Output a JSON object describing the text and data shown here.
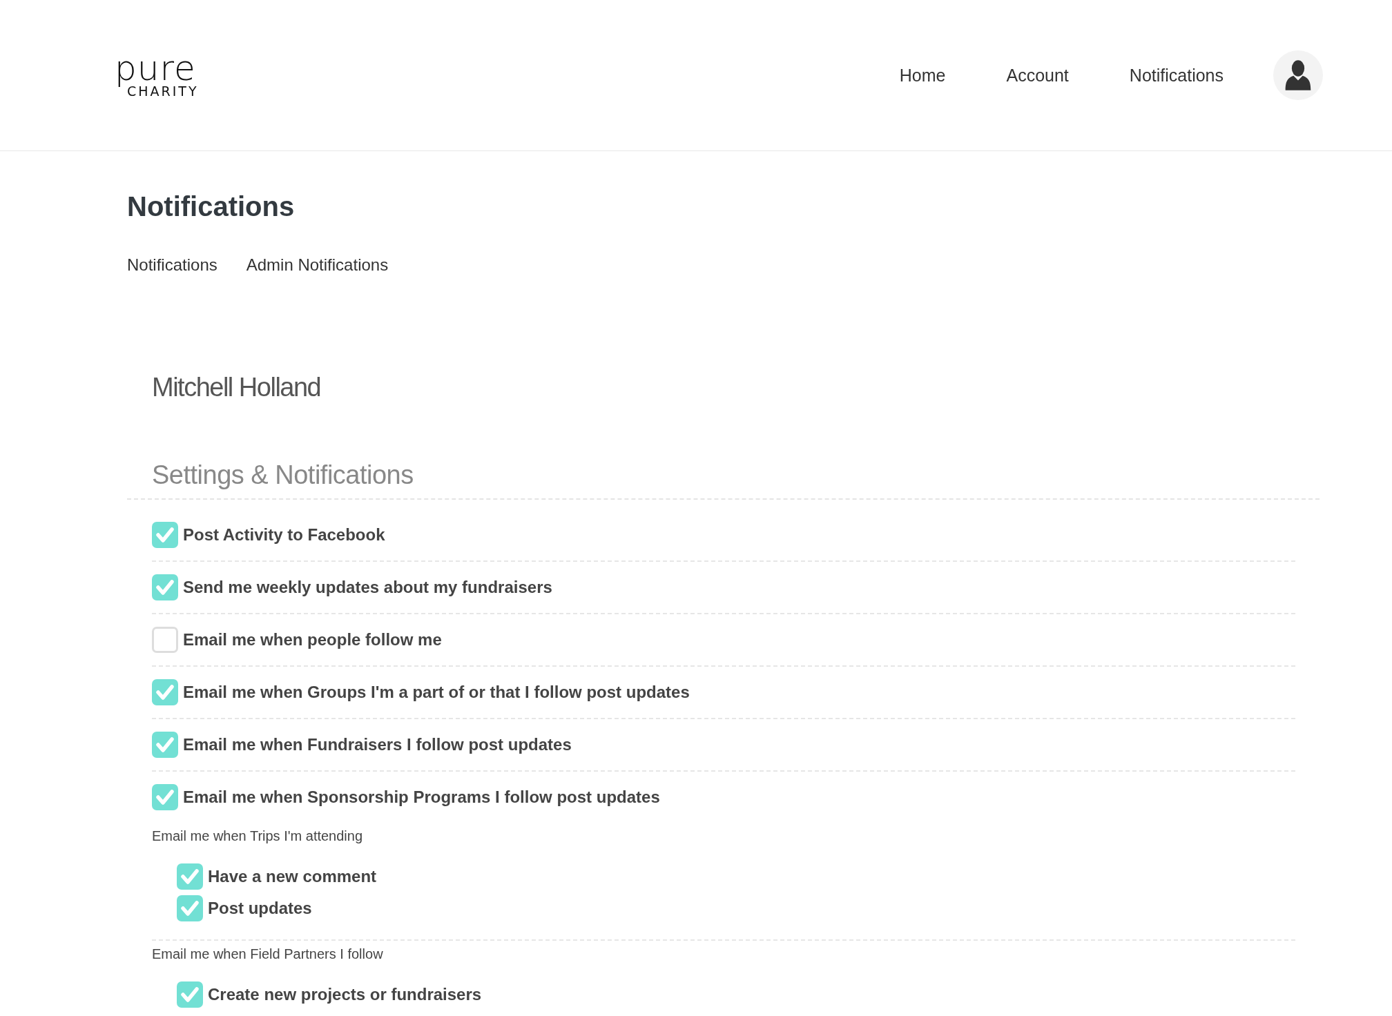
{
  "header": {
    "logo": {
      "word": "pure",
      "tagline": "CHARITY"
    },
    "nav": [
      {
        "label": "Home"
      },
      {
        "label": "Account"
      },
      {
        "label": "Notifications"
      }
    ]
  },
  "page": {
    "title": "Notifications",
    "tabs": [
      {
        "label": "Notifications"
      },
      {
        "label": "Admin Notifications"
      }
    ],
    "profile_name": "Mitchell Holland",
    "section_title": "Settings & Notifications",
    "settings": [
      {
        "kind": "checkbox",
        "label": "Post Activity to Facebook",
        "checked": true
      },
      {
        "kind": "checkbox",
        "label": "Send me weekly updates about my fundraisers",
        "checked": true
      },
      {
        "kind": "checkbox",
        "label": "Email me when people follow me",
        "checked": false
      },
      {
        "kind": "checkbox",
        "label": "Email me when Groups I'm a part of or that I follow post updates",
        "checked": true
      },
      {
        "kind": "checkbox",
        "label": "Email me when Fundraisers I follow post updates",
        "checked": true
      },
      {
        "kind": "checkbox",
        "label": "Email me when Sponsorship Programs I follow post updates",
        "checked": true
      },
      {
        "kind": "group",
        "label": "Email me when Trips I'm attending",
        "items": [
          {
            "label": "Have a new comment",
            "checked": true
          },
          {
            "label": "Post updates",
            "checked": true
          }
        ]
      },
      {
        "kind": "group",
        "label": "Email me when Field Partners I follow",
        "items": [
          {
            "label": "Create new projects or fundraisers",
            "checked": true
          }
        ]
      }
    ]
  }
}
